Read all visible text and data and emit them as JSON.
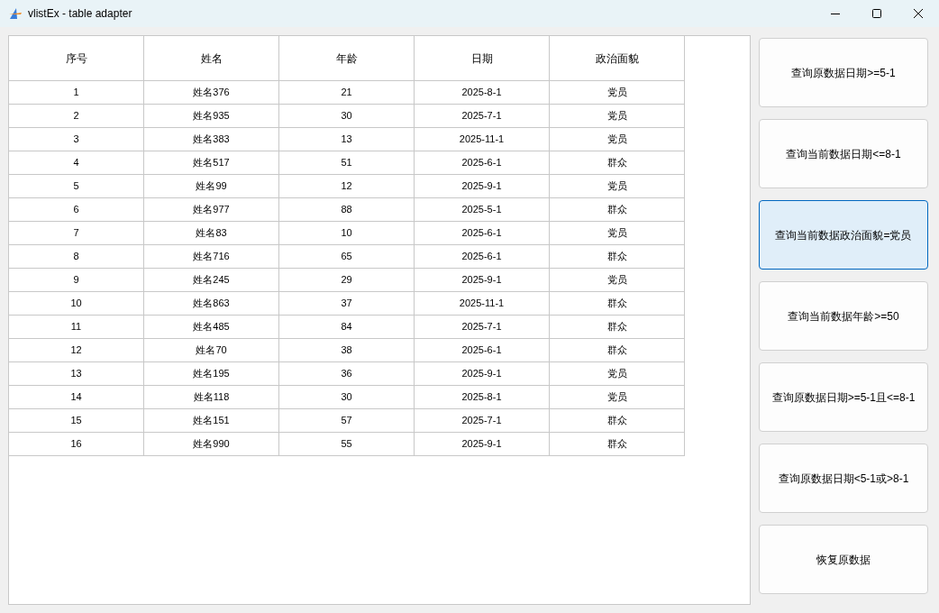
{
  "window": {
    "title": "vlistEx - table adapter"
  },
  "table": {
    "columns": [
      "序号",
      "姓名",
      "年龄",
      "日期",
      "政治面貌"
    ],
    "rows": [
      [
        "1",
        "姓名376",
        "21",
        "2025-8-1",
        "党员"
      ],
      [
        "2",
        "姓名935",
        "30",
        "2025-7-1",
        "党员"
      ],
      [
        "3",
        "姓名383",
        "13",
        "2025-11-1",
        "党员"
      ],
      [
        "4",
        "姓名517",
        "51",
        "2025-6-1",
        "群众"
      ],
      [
        "5",
        "姓名99",
        "12",
        "2025-9-1",
        "党员"
      ],
      [
        "6",
        "姓名977",
        "88",
        "2025-5-1",
        "群众"
      ],
      [
        "7",
        "姓名83",
        "10",
        "2025-6-1",
        "党员"
      ],
      [
        "8",
        "姓名716",
        "65",
        "2025-6-1",
        "群众"
      ],
      [
        "9",
        "姓名245",
        "29",
        "2025-9-1",
        "党员"
      ],
      [
        "10",
        "姓名863",
        "37",
        "2025-11-1",
        "群众"
      ],
      [
        "11",
        "姓名485",
        "84",
        "2025-7-1",
        "群众"
      ],
      [
        "12",
        "姓名70",
        "38",
        "2025-6-1",
        "群众"
      ],
      [
        "13",
        "姓名195",
        "36",
        "2025-9-1",
        "党员"
      ],
      [
        "14",
        "姓名118",
        "30",
        "2025-8-1",
        "党员"
      ],
      [
        "15",
        "姓名151",
        "57",
        "2025-7-1",
        "群众"
      ],
      [
        "16",
        "姓名990",
        "55",
        "2025-9-1",
        "群众"
      ]
    ]
  },
  "buttons": [
    {
      "label": "查询原数据日期>=5-1",
      "selected": false
    },
    {
      "label": "查询当前数据日期<=8-1",
      "selected": false
    },
    {
      "label": "查询当前数据政治面貌=党员",
      "selected": true
    },
    {
      "label": "查询当前数据年龄>=50",
      "selected": false
    },
    {
      "label": "查询原数据日期>=5-1且<=8-1",
      "selected": false
    },
    {
      "label": "查询原数据日期<5-1或>8-1",
      "selected": false
    },
    {
      "label": "恢复原数据",
      "selected": false
    }
  ]
}
